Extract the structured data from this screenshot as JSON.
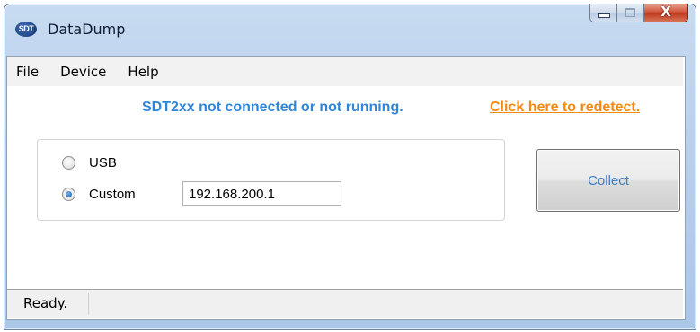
{
  "window": {
    "title": "DataDump",
    "icon_text": "SDT",
    "close_glyph": "X"
  },
  "menu": {
    "items": [
      {
        "label": "File"
      },
      {
        "label": "Device"
      },
      {
        "label": "Help"
      }
    ]
  },
  "status_message": {
    "text": "SDT2xx not connected or not running.",
    "link": "Click here to redetect.",
    "text_color": "#2f86d8",
    "link_color": "#f28a10"
  },
  "connection": {
    "options": [
      {
        "label": "USB",
        "checked": false
      },
      {
        "label": "Custom",
        "checked": true
      }
    ],
    "custom_address": "192.168.200.1"
  },
  "actions": {
    "collect_label": "Collect"
  },
  "statusbar": {
    "text": "Ready."
  }
}
